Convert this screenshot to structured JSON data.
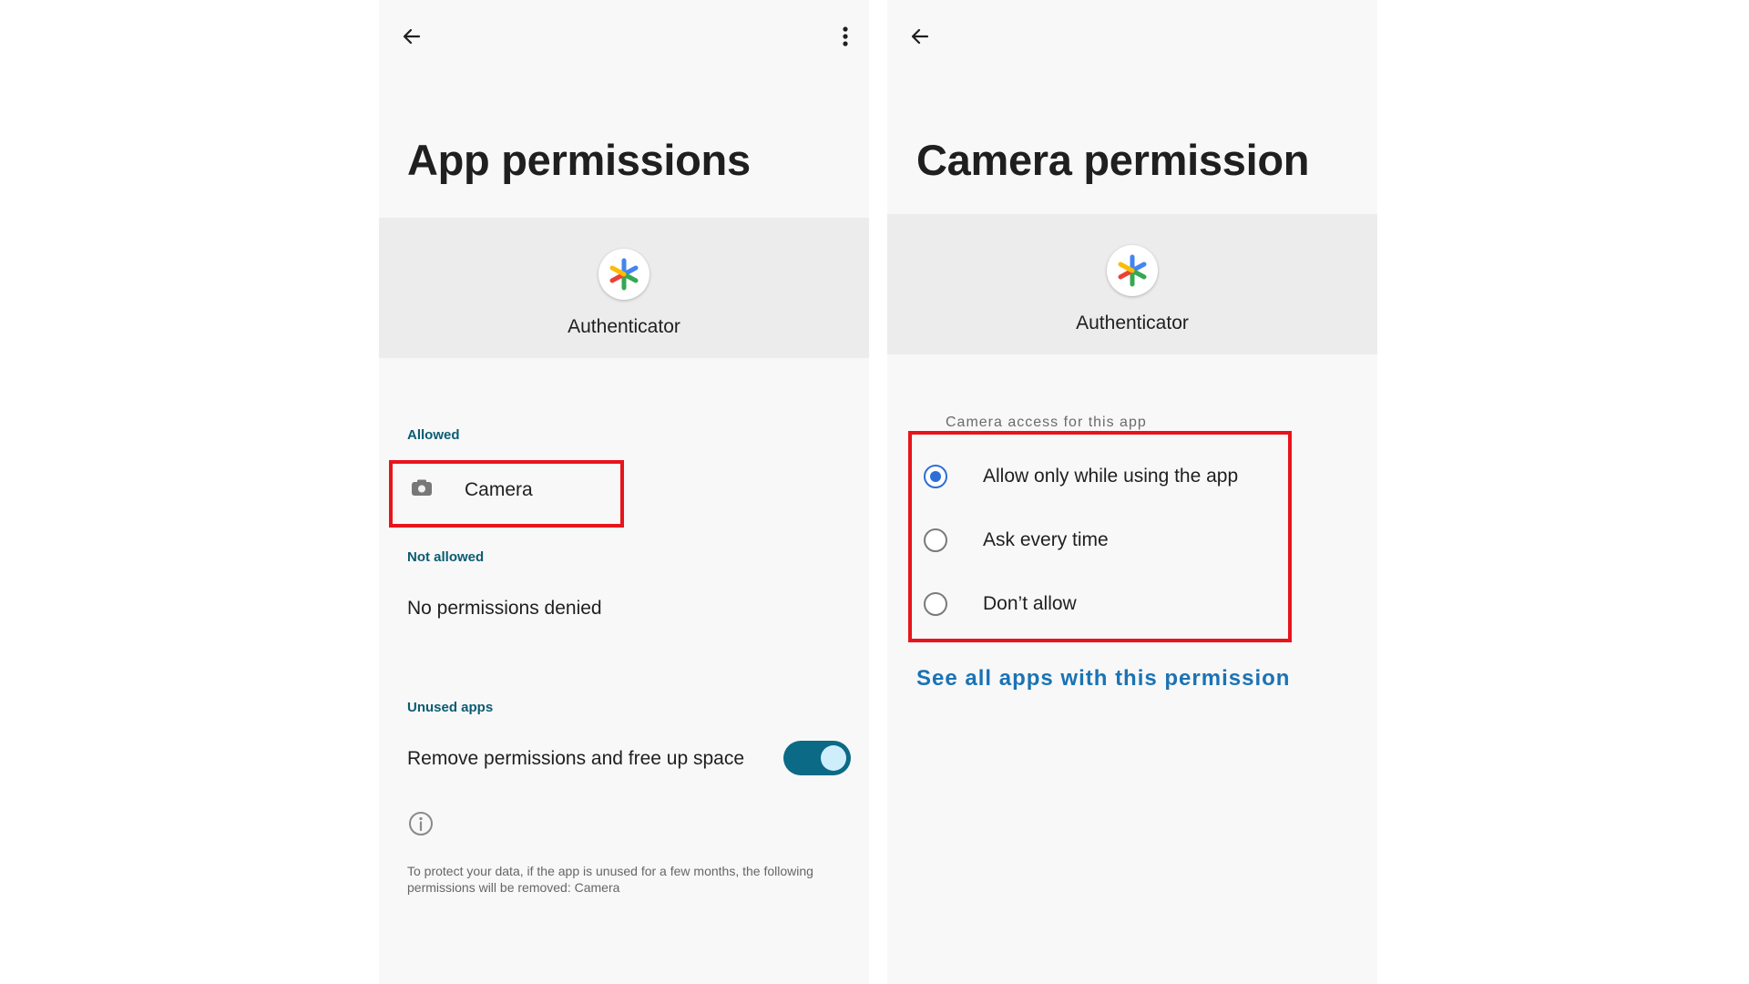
{
  "left_screen": {
    "title": "App permissions",
    "app_name": "Authenticator",
    "sections": {
      "allowed_label": "Allowed",
      "allowed_item": "Camera",
      "not_allowed_label": "Not allowed",
      "not_allowed_item": "No permissions denied",
      "unused_label": "Unused apps",
      "unused_item": "Remove permissions and free up space",
      "unused_toggle_on": true
    },
    "footnote": "To protect your data, if the app is unused for a few months, the following permissions will be removed: Camera",
    "icons": [
      "back-arrow-icon",
      "more-vert-icon",
      "camera-icon",
      "info-icon"
    ]
  },
  "right_screen": {
    "title": "Camera permission",
    "app_name": "Authenticator",
    "subheader": "Camera access for this app",
    "options": [
      {
        "label": "Allow only while using the app",
        "selected": true
      },
      {
        "label": "Ask every time",
        "selected": false
      },
      {
        "label": "Don’t allow",
        "selected": false
      }
    ],
    "link": "See all apps with this permission",
    "icons": [
      "back-arrow-icon"
    ]
  },
  "colors": {
    "highlight": "#e8141b",
    "accent_teal": "#0b6a86",
    "radio_blue": "#2c6fd6",
    "link_blue": "#1a73b5"
  }
}
